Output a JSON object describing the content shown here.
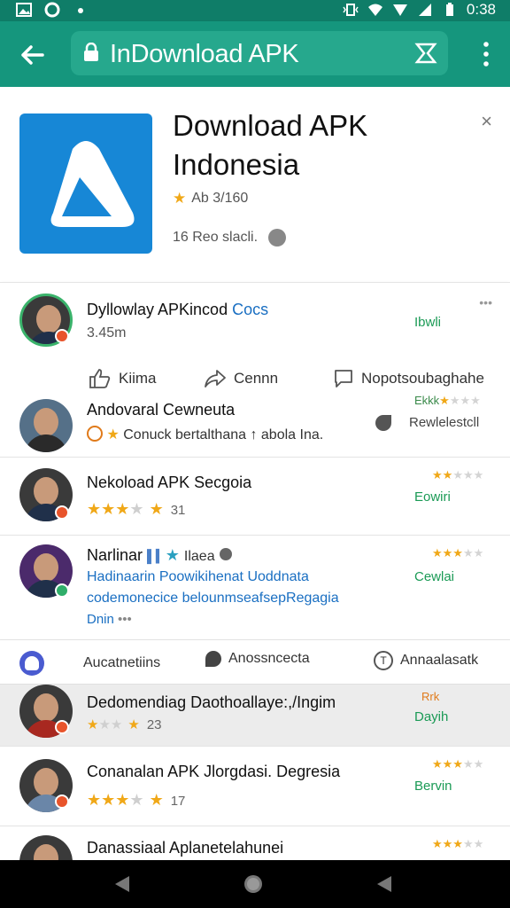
{
  "status_bar": {
    "time": "0:38"
  },
  "app_bar": {
    "url": "InDownload APK"
  },
  "banner": {
    "title_line1": "Download APK",
    "title_line2": "Indonesia",
    "rating_text": "Ab 3/160",
    "meta_text": "16 Reo slacli.",
    "close": "×"
  },
  "featured": {
    "title": "Dyllowlay APKincod",
    "title_link": "Cocs",
    "size": "3.45m",
    "action": "Ibwli",
    "more": "•••",
    "like_label": "Kiima",
    "share_label": "Cennn",
    "comment_label": "Nopotsoubaghahe"
  },
  "rows": [
    {
      "title": "Andovaral Cewneuta",
      "sub": "Conuck bertalthana ↑ abola Ina.",
      "action": "Rewlelestcll",
      "stars_label": "Ekkk",
      "rating": 2
    },
    {
      "title": "Nekoload APK Secgoia",
      "stars": 3,
      "count": "31",
      "action": "Eowiri",
      "rating": 2
    },
    {
      "title": "Narlinar",
      "title_tag": "Ilaea",
      "desc1": "Hadinaarin Poowikihenat Uoddnata",
      "desc2": "codemonecice belounmseafsepRegagia",
      "desc3": "Dnin",
      "action": "Cewlai",
      "rating": 3
    }
  ],
  "filters": {
    "chip1": "Aucatnetiins",
    "chip2": "Anossncecta",
    "chip3": "Annaalasatk"
  },
  "rows2": [
    {
      "title": "Dedomendiag Daothoallaye:,/Ingim",
      "stars": 3,
      "count": "23",
      "badge_text": "Rrk",
      "action": "Dayih",
      "rating": 0
    },
    {
      "title": "Conanalan APK Jlorgdasi. Degresia",
      "stars": 4,
      "count": "17",
      "action": "Bervin",
      "rating": 3
    },
    {
      "title": "Danassiaal Aplanetelahunei",
      "rating": 3
    }
  ],
  "colors": {
    "app_bar": "#15967d",
    "status_bar": "#0f7d68",
    "accent_green": "#1a9a55",
    "star": "#f0a818",
    "app_icon": "#1787d6"
  },
  "icons": {
    "back": "arrow-left-icon",
    "lock": "lock-icon",
    "tabs": "tabs-icon",
    "menu": "more-vert-icon",
    "like": "thumbs-up-icon",
    "share": "share-icon",
    "comment": "comment-icon"
  }
}
